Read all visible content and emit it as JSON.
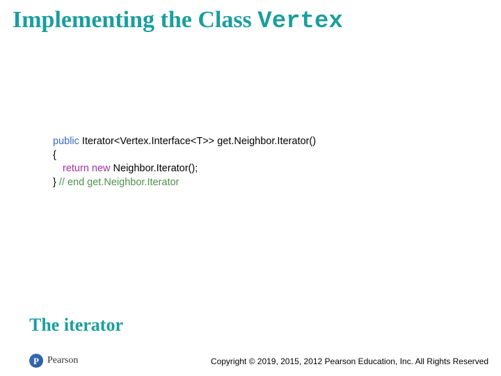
{
  "title": {
    "prefix": "Implementing the Class ",
    "class_name": "Vertex"
  },
  "code": {
    "line1_kw": "public",
    "line1_rest": " Iterator<Vertex.Interface<T>> get.Neighbor.Iterator()",
    "line2": "{",
    "line3_kw": "return new",
    "line3_rest": " Neighbor.Iterator();",
    "line4_brace": "} ",
    "line4_comment": "// end get.Neighbor.Iterator"
  },
  "subtitle": "The iterator",
  "footer": {
    "brand": "Pearson",
    "brand_letter": "P",
    "copyright": "Copyright © 2019, 2015, 2012 Pearson Education, Inc. All Rights Reserved"
  }
}
